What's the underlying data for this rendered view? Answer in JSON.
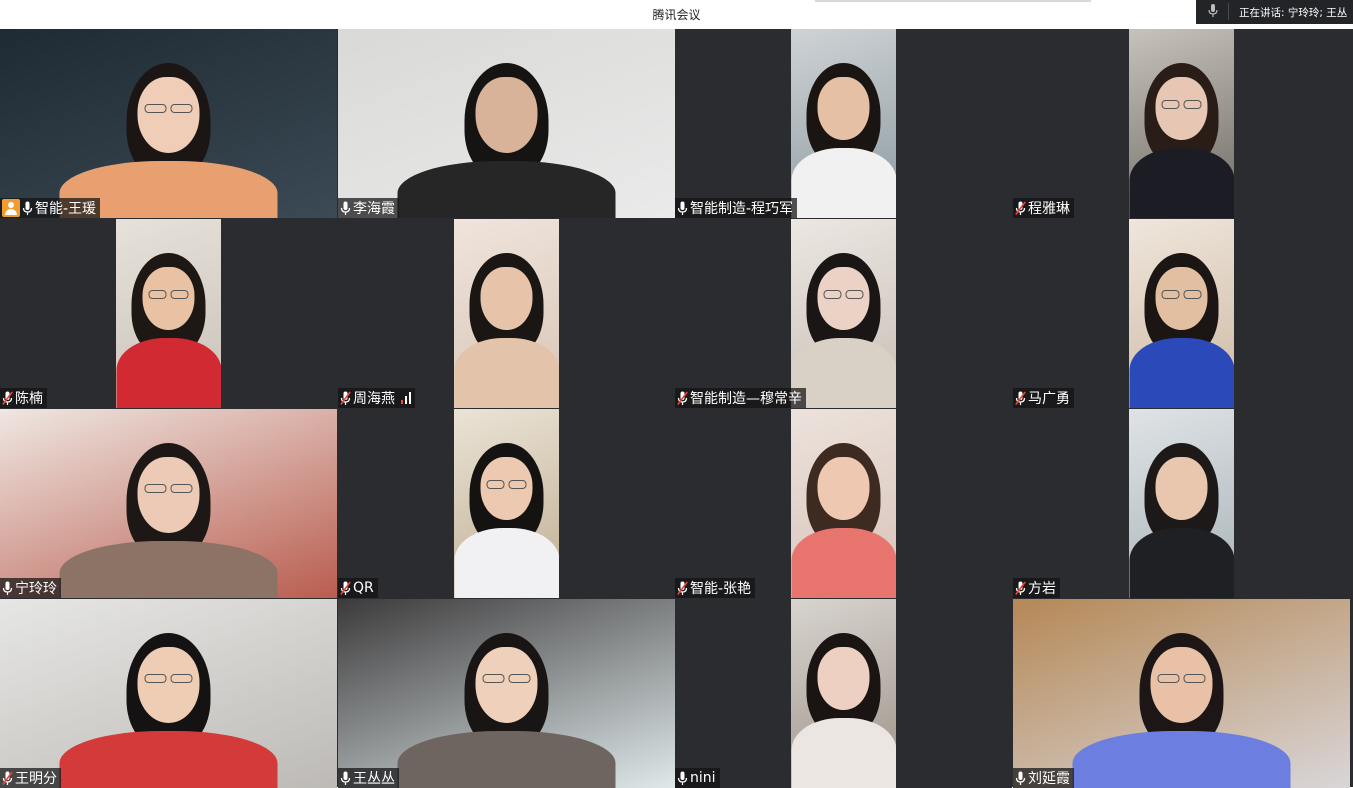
{
  "app": {
    "title": "腾讯会议"
  },
  "speaking_indicator": {
    "text": "正在讲话: 宁玲玲; 王丛"
  },
  "tiles": [
    {
      "name": "智能-王瑗",
      "mic": "on",
      "host": true,
      "video": "full",
      "active": false,
      "bg": [
        "#1f2a33",
        "#3b4a55"
      ],
      "skin": "#efcdb6",
      "hair": "#1b1614",
      "top": "#e8a070",
      "glasses": true
    },
    {
      "name": "李海霞",
      "mic": "on",
      "host": false,
      "video": "full",
      "active": false,
      "bg": [
        "#d9d9d7",
        "#eaeaea"
      ],
      "skin": "#d9b29a",
      "hair": "#161413",
      "top": "#262626",
      "glasses": false
    },
    {
      "name": "智能制造-程巧军",
      "mic": "on",
      "host": false,
      "video": "portrait",
      "active": false,
      "bg": [
        "#cfd3d6",
        "#8c9aa0"
      ],
      "skin": "#e6c0a4",
      "hair": "#1a1412",
      "top": "#f1f1f1",
      "glasses": false
    },
    {
      "name": "程雅琳",
      "mic": "muted",
      "host": false,
      "video": "portrait",
      "active": false,
      "bg": [
        "#c7c2bb",
        "#6f6a64"
      ],
      "skin": "#e7c7b3",
      "hair": "#2a1c16",
      "top": "#1c1d24",
      "glasses": true
    },
    {
      "name": "陈楠",
      "mic": "muted",
      "host": false,
      "video": "portrait",
      "active": false,
      "bg": [
        "#e6e1da",
        "#c9c2b8"
      ],
      "skin": "#e9c2a4",
      "hair": "#1e1814",
      "top": "#d22a32",
      "glasses": true
    },
    {
      "name": "周海燕",
      "mic": "muted",
      "host": false,
      "video": "portrait",
      "active": false,
      "signal": true,
      "bg": [
        "#efe4dc",
        "#d8c5b6"
      ],
      "skin": "#e7c3aa",
      "hair": "#1a1614",
      "top": "#e3c4aa",
      "glasses": false
    },
    {
      "name": "智能制造—穆常辛",
      "mic": "muted",
      "host": false,
      "video": "portrait",
      "active": false,
      "bg": [
        "#ece7e2",
        "#c8bfb6"
      ],
      "skin": "#ecd2c4",
      "hair": "#1a1615",
      "top": "#d9d0c6",
      "glasses": true
    },
    {
      "name": "马广勇",
      "mic": "muted",
      "host": false,
      "video": "portrait",
      "active": false,
      "bg": [
        "#efe6dc",
        "#cdb9a3"
      ],
      "skin": "#e2bfa0",
      "hair": "#1b1614",
      "top": "#2b49b8",
      "glasses": true
    },
    {
      "name": "宁玲玲",
      "mic": "on",
      "host": false,
      "video": "full",
      "active": true,
      "bg": [
        "#efe7e2",
        "#b95d4f"
      ],
      "skin": "#eccab5",
      "hair": "#1d1816",
      "top": "#8d7366",
      "glasses": true
    },
    {
      "name": "QR",
      "mic": "muted",
      "host": false,
      "video": "portrait",
      "active": false,
      "bg": [
        "#ebe3d6",
        "#bfae92"
      ],
      "skin": "#ecc9b0",
      "hair": "#151311",
      "top": "#f1f1f3",
      "glasses": true
    },
    {
      "name": "智能-张艳",
      "mic": "muted",
      "host": false,
      "video": "portrait",
      "active": false,
      "bg": [
        "#ece2dc",
        "#d7c3b8"
      ],
      "skin": "#efc8b2",
      "hair": "#3d2a20",
      "top": "#e7756e",
      "glasses": false
    },
    {
      "name": "方岩",
      "mic": "muted",
      "host": false,
      "video": "portrait",
      "active": false,
      "bg": [
        "#dfe3e6",
        "#a8b3b9"
      ],
      "skin": "#e9c7ae",
      "hair": "#1c1918",
      "top": "#1e2024",
      "glasses": false
    },
    {
      "name": "王明分",
      "mic": "muted",
      "host": false,
      "video": "full",
      "active": false,
      "bg": [
        "#e6e6e4",
        "#bdbab6"
      ],
      "skin": "#efcdb5",
      "hair": "#141212",
      "top": "#d33a3a",
      "glasses": true
    },
    {
      "name": "王丛丛",
      "mic": "on",
      "host": false,
      "video": "full",
      "active": false,
      "bg": [
        "#3c3a3b",
        "#dfe9ea"
      ],
      "skin": "#efd0bb",
      "hair": "#191515",
      "top": "#6e6560",
      "glasses": true
    },
    {
      "name": "nini",
      "mic": "on",
      "host": false,
      "video": "portrait",
      "active": false,
      "bg": [
        "#d8d4cf",
        "#9d9288"
      ],
      "skin": "#edd0c1",
      "hair": "#1a1412",
      "top": "#ece6e2",
      "glasses": false
    },
    {
      "name": "刘延霞",
      "mic": "on",
      "host": false,
      "video": "full",
      "active": false,
      "bg": [
        "#b58856",
        "#d9d6d8"
      ],
      "skin": "#e8c1a7",
      "hair": "#1c1716",
      "top": "#6c7fe0",
      "glasses": true
    }
  ]
}
